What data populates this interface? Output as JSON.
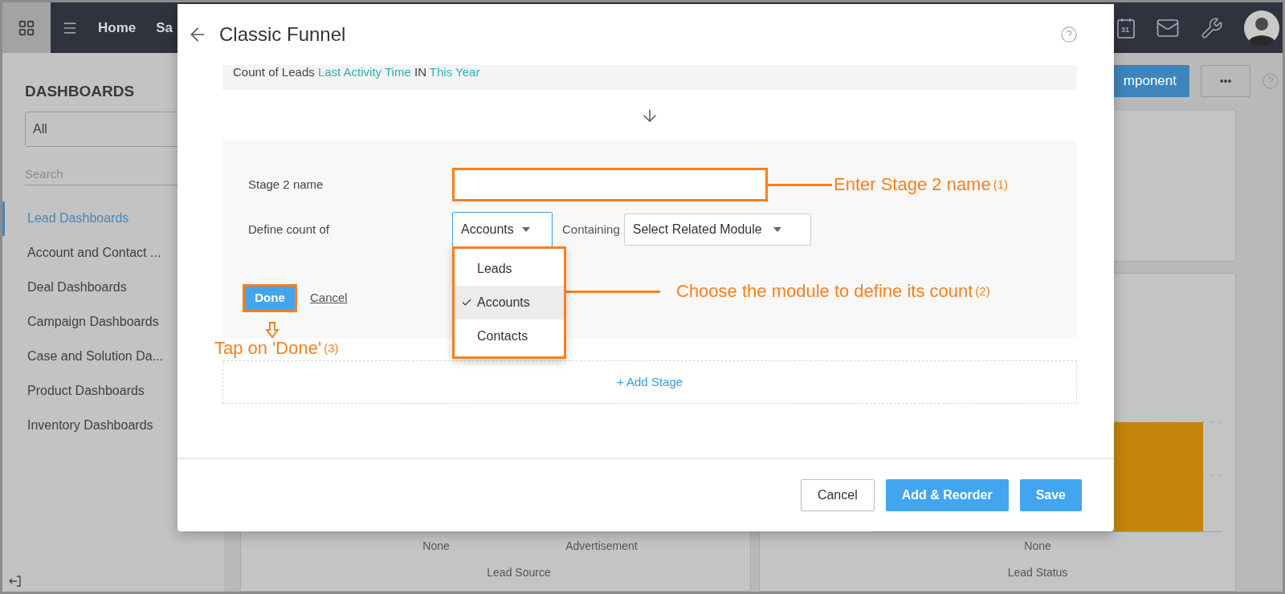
{
  "app_bar": {
    "nav": [
      "Home",
      "Sa"
    ],
    "calendar_day": "31"
  },
  "toolbar": {
    "add_button": "mponent",
    "more_button": "•••"
  },
  "sidebar": {
    "title": "DASHBOARDS",
    "filter": "All",
    "search": {
      "placeholder": "Search"
    },
    "items": [
      {
        "label": "Lead Dashboards",
        "selected": true
      },
      {
        "label": "Account and Contact ...",
        "selected": false
      },
      {
        "label": "Deal Dashboards",
        "selected": false
      },
      {
        "label": "Campaign Dashboards",
        "selected": false
      },
      {
        "label": "Case and Solution Da...",
        "selected": false
      },
      {
        "label": "Product Dashboards",
        "selected": false
      },
      {
        "label": "Inventory Dashboards",
        "selected": false
      }
    ]
  },
  "cards": [
    {
      "labels": [
        "None",
        "Advertisement"
      ],
      "axis_title": "Lead Source"
    },
    {
      "labels": [
        "None"
      ],
      "axis_title": "Lead Status"
    }
  ],
  "modal": {
    "title": "Classic Funnel",
    "stage_1": [
      {
        "text": "Count of Leads",
        "kind": "plain"
      },
      {
        "text": "Last Activity Time",
        "kind": "link"
      },
      {
        "text": "IN",
        "kind": "plain"
      },
      {
        "text": "This Year",
        "kind": "link"
      }
    ],
    "stage_2": {
      "name_label": "Stage 2 name",
      "count_label": "Define count of",
      "module": "Accounts",
      "containing_label": "Containing",
      "related_module": "Select Related Module",
      "menu": [
        {
          "label": "Leads",
          "selected": false
        },
        {
          "label": "Accounts",
          "selected": true
        },
        {
          "label": "Contacts",
          "selected": false
        }
      ],
      "done": "Done",
      "cancel": "Cancel"
    },
    "add_stage": "+ Add Stage",
    "footer_buttons": [
      {
        "label": "Cancel",
        "kind": "secondary"
      },
      {
        "label": "Add & Reorder",
        "kind": "primary"
      },
      {
        "label": "Save",
        "kind": "primary"
      }
    ]
  },
  "annotations": [
    {
      "text": "Enter Stage 2 name",
      "number": "(1)"
    },
    {
      "text": "Choose the module to define its count",
      "number": "(2)"
    },
    {
      "text": "Tap on 'Done'",
      "number": "(3)"
    }
  ]
}
